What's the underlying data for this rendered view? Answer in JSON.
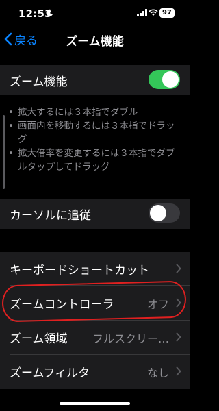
{
  "status_bar": {
    "time": "12:53",
    "battery": "97",
    "icons": [
      "moon-icon",
      "signal-icon",
      "wifi-icon",
      "battery-icon"
    ]
  },
  "nav": {
    "back_label": "戻る",
    "title": "ズーム機能"
  },
  "zoom_toggle": {
    "label": "ズーム機能",
    "on": true
  },
  "description": [
    "拡大するには３本指でダブル",
    "画面内を移動するには３本指でドラッグ",
    "拡大倍率を変更するには３本指でダブルタップしてドラッグ"
  ],
  "follow_cursor": {
    "label": "カーソルに追従",
    "on": false
  },
  "settings": [
    {
      "label": "キーボードショートカット",
      "value": ""
    },
    {
      "label": "ズームコントローラ",
      "value": "オフ"
    },
    {
      "label": "ズーム領域",
      "value": "フルスクリー…"
    },
    {
      "label": "ズームフィルタ",
      "value": "なし"
    }
  ],
  "colors": {
    "accent": "#0a84ff",
    "toggle_on": "#34c759",
    "annotation": "#e02020",
    "cell_background": "#1c1c1e"
  }
}
